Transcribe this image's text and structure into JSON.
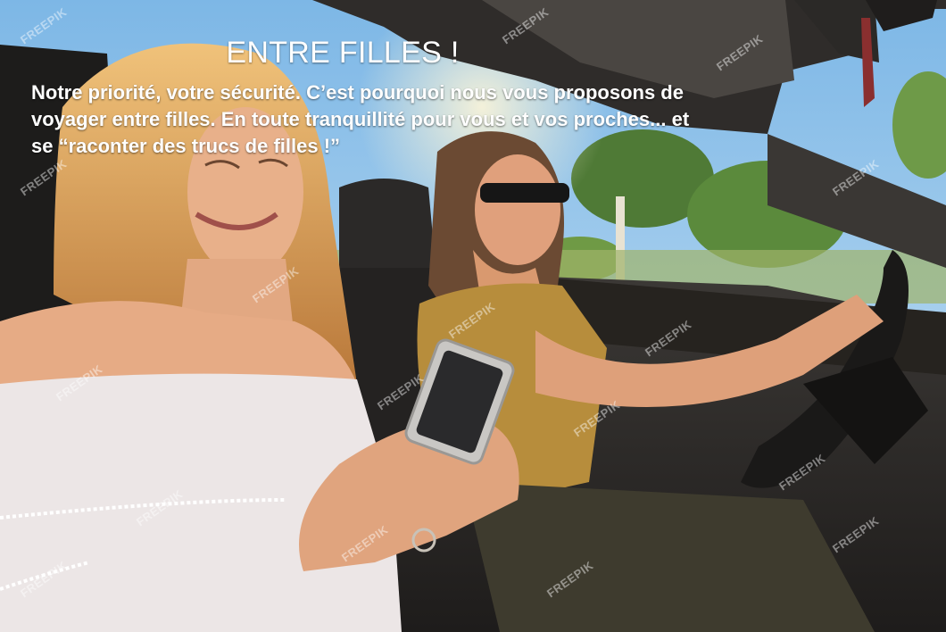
{
  "banner": {
    "title": "ENTRE FILLES !",
    "body_lines": [
      "Notre priorité, votre sécurité. C’est pourquoi nous vous proposons de",
      "voyager entre filles. En toute tranquillité pour vous et vos proches... et",
      "se “raconter des trucs de filles !”"
    ]
  },
  "watermark": {
    "text": "FREEPIK"
  },
  "colors": {
    "sky": "#8ec3ea",
    "car_interior": "#2c2a28",
    "white_top": "#ece6e6",
    "mustard_top": "#b78d3c",
    "skin": "#e2a882",
    "hair_blonde": "#d9a15c",
    "hair_brown": "#6b4a33",
    "text": "#ffffff"
  }
}
